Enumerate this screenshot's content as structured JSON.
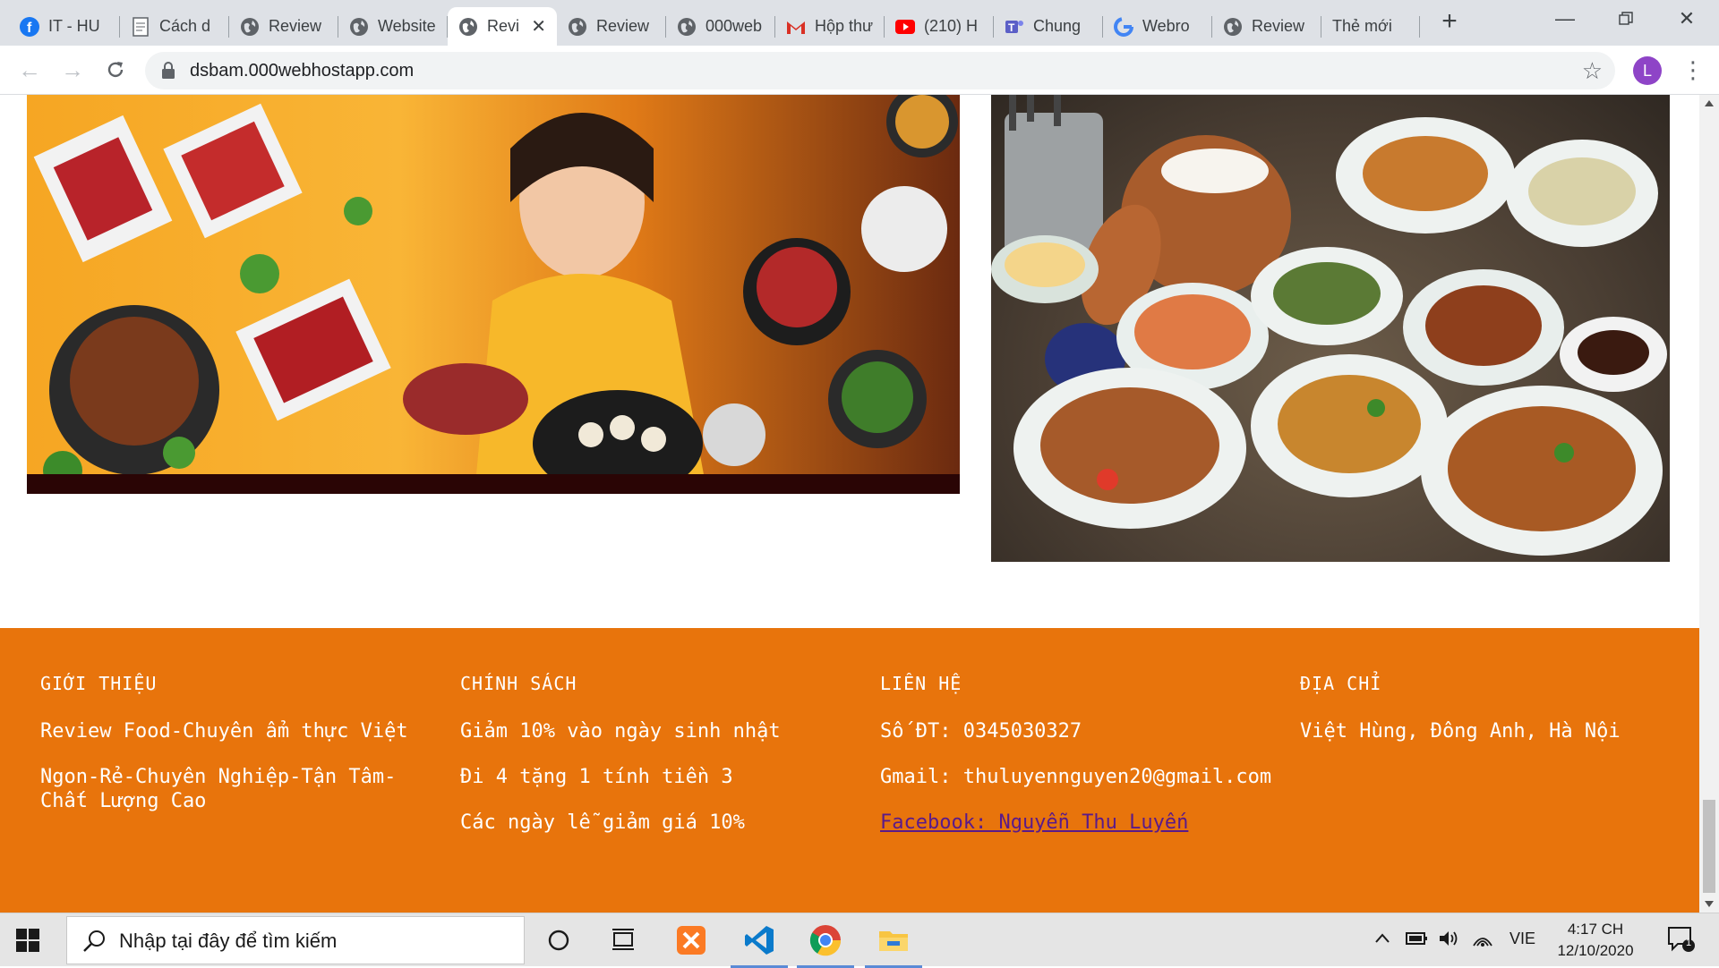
{
  "browser": {
    "tabs": [
      {
        "title": "IT - HU",
        "icon": "facebook-icon"
      },
      {
        "title": "Cách d",
        "icon": "document-icon"
      },
      {
        "title": "Review",
        "icon": "globe-icon"
      },
      {
        "title": "Website",
        "icon": "globe-icon"
      },
      {
        "title": "Revi",
        "icon": "globe-icon",
        "active": true
      },
      {
        "title": "Review",
        "icon": "globe-icon"
      },
      {
        "title": "000web",
        "icon": "globe-icon"
      },
      {
        "title": "Hộp thư",
        "icon": "gmail-icon"
      },
      {
        "title": "(210) H",
        "icon": "youtube-icon"
      },
      {
        "title": "Chung",
        "icon": "teams-icon"
      },
      {
        "title": "Webro",
        "icon": "google-icon"
      },
      {
        "title": "Review",
        "icon": "globe-icon"
      },
      {
        "title": "Thẻ mới",
        "icon": ""
      }
    ],
    "url": "dsbam.000webhostapp.com",
    "profile_initial": "L"
  },
  "footer": {
    "intro": {
      "heading": "GIỚI THIỆU",
      "lines": [
        "Review Food-Chuyên ẩm thực Việt",
        "Ngon-Rẻ-Chuyên Nghiệp-Tận Tâm-Chất Lượng Cao"
      ]
    },
    "policy": {
      "heading": "CHÍNH SÁCH",
      "lines": [
        "Giảm 10% vào ngày sinh nhật",
        "Đi 4 tặng 1 tính tiền 3",
        "Các ngày lễ giảm giá 10%"
      ]
    },
    "contact": {
      "heading": "LIÊN HỆ",
      "phone": "Số ĐT: 0345030327",
      "gmail": "Gmail: thuluyennguyen20@gmail.com",
      "facebook": "Facebook: Nguyễn Thu Luyến"
    },
    "address": {
      "heading": "ĐỊA CHỈ",
      "text": "Việt Hùng, Đông Anh, Hà Nội"
    }
  },
  "taskbar": {
    "search_placeholder": "Nhập tại đây để tìm kiếm",
    "language": "VIE",
    "time": "4:17 CH",
    "date": "12/10/2020",
    "notification_count": "1"
  },
  "colors": {
    "footer_bg": "#e8740c",
    "link": "#5a1a8a",
    "tab_strip": "#dee1e6"
  }
}
